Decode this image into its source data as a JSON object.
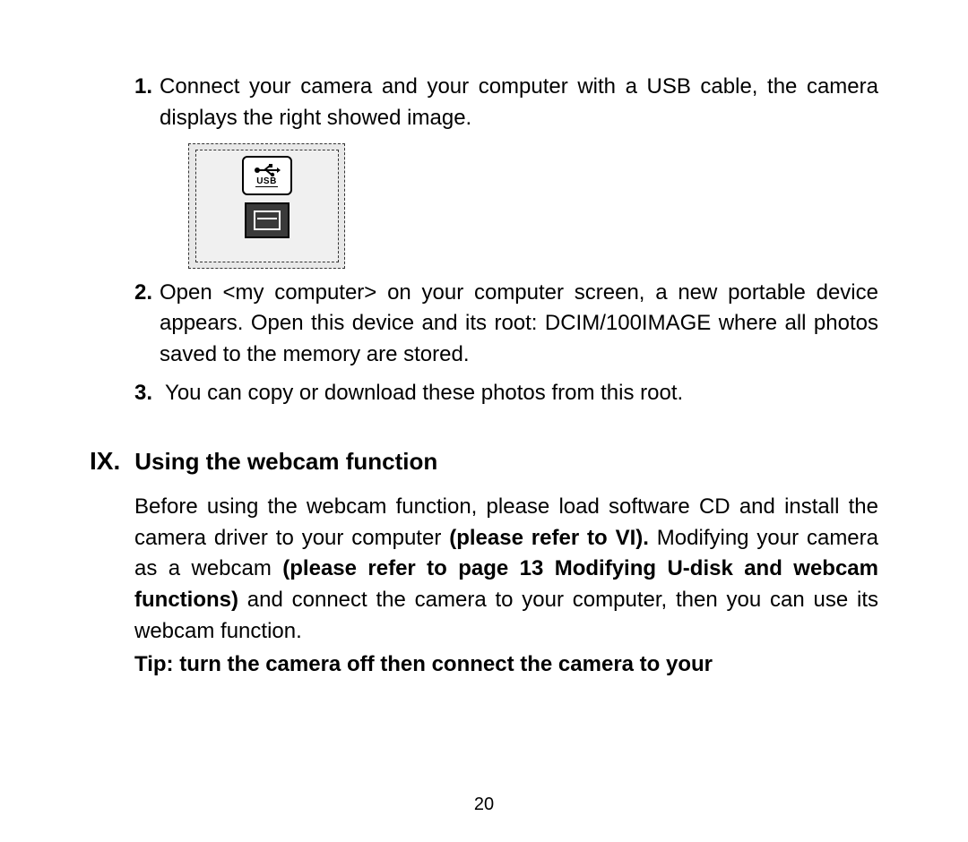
{
  "list": {
    "item1": {
      "num": "1.",
      "text": "Connect your camera and your computer with a USB cable, the camera displays the right showed image."
    },
    "item2": {
      "num": "2.",
      "text": "Open <my computer> on your computer screen, a new portable device appears. Open this device and its root: DCIM/100IMAGE where all photos saved to the memory are stored."
    },
    "item3": {
      "num": "3.",
      "text": "You can copy or download these photos from this root."
    }
  },
  "image": {
    "usb_label": "USB"
  },
  "section": {
    "num": "IX.",
    "title": "Using the webcam function"
  },
  "para": {
    "pre": "Before using the webcam function, please load software CD and install the camera driver to your computer ",
    "b1": "(please refer to VI).",
    "mid": " Modifying your camera as a webcam ",
    "b2": "(please refer to page 13 Modifying U-disk and webcam functions)",
    "post": " and connect the camera to your computer, then you can use its webcam function."
  },
  "tip": "Tip: turn the camera off then connect the camera to your",
  "page_number": "20"
}
